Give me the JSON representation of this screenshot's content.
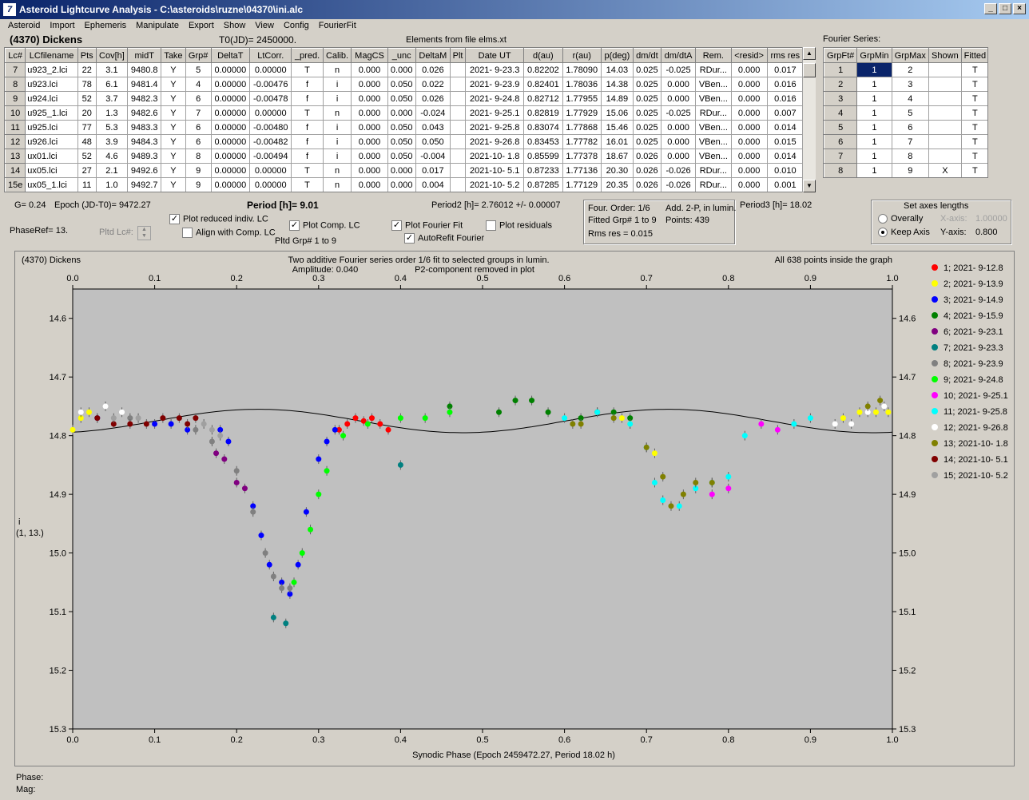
{
  "window": {
    "title": "Asteroid Lightcurve Analysis - C:\\asteroids\\ruzne\\04370\\ini.alc",
    "min": "_",
    "max": "□",
    "close": "×"
  },
  "menu": [
    "Asteroid",
    "Import",
    "Ephemeris",
    "Manipulate",
    "Export",
    "Show",
    "View",
    "Config",
    "FourierFit"
  ],
  "header": {
    "object": "(4370) Dickens",
    "t0": "T0(JD)= 2450000.",
    "elements": "Elements from file elms.xt",
    "fourier_label": "Fourier Series:"
  },
  "lc_table": {
    "columns": [
      "Lc#",
      "LCfilename",
      "Pts",
      "Cov[h]",
      "midT",
      "Take",
      "Grp#",
      "DeltaT",
      "LtCorr.",
      "_pred.",
      "Calib.",
      "MagCS",
      "_unc",
      "DeltaM",
      "Plt",
      "Date UT",
      "d(au)",
      "r(au)",
      "p(deg)",
      "dm/dt",
      "dm/dtA",
      "Rem.",
      "<resid>",
      "rms res"
    ],
    "rows": [
      [
        "7",
        "u923_2.lci",
        "22",
        "3.1",
        "9480.8",
        "Y",
        "5",
        "0.00000",
        "0.00000",
        "T",
        "n",
        "0.000",
        "0.000",
        "0.026",
        "",
        "2021- 9-23.3",
        "0.82202",
        "1.78090",
        "14.03",
        "0.025",
        "-0.025",
        "RDur...",
        "0.000",
        "0.017"
      ],
      [
        "8",
        "u923.lci",
        "78",
        "6.1",
        "9481.4",
        "Y",
        "4",
        "0.00000",
        "-0.00476",
        "f",
        "i",
        "0.000",
        "0.050",
        "0.022",
        "",
        "2021- 9-23.9",
        "0.82401",
        "1.78036",
        "14.38",
        "0.025",
        "0.000",
        "VBen...",
        "0.000",
        "0.016"
      ],
      [
        "9",
        "u924.lci",
        "52",
        "3.7",
        "9482.3",
        "Y",
        "6",
        "0.00000",
        "-0.00478",
        "f",
        "i",
        "0.000",
        "0.050",
        "0.026",
        "",
        "2021- 9-24.8",
        "0.82712",
        "1.77955",
        "14.89",
        "0.025",
        "0.000",
        "VBen...",
        "0.000",
        "0.016"
      ],
      [
        "10",
        "u925_1.lci",
        "20",
        "1.3",
        "9482.6",
        "Y",
        "7",
        "0.00000",
        "0.00000",
        "T",
        "n",
        "0.000",
        "0.000",
        "-0.024",
        "",
        "2021- 9-25.1",
        "0.82819",
        "1.77929",
        "15.06",
        "0.025",
        "-0.025",
        "RDur...",
        "0.000",
        "0.007"
      ],
      [
        "11",
        "u925.lci",
        "77",
        "5.3",
        "9483.3",
        "Y",
        "6",
        "0.00000",
        "-0.00480",
        "f",
        "i",
        "0.000",
        "0.050",
        "0.043",
        "",
        "2021- 9-25.8",
        "0.83074",
        "1.77868",
        "15.46",
        "0.025",
        "0.000",
        "VBen...",
        "0.000",
        "0.014"
      ],
      [
        "12",
        "u926.lci",
        "48",
        "3.9",
        "9484.3",
        "Y",
        "6",
        "0.00000",
        "-0.00482",
        "f",
        "i",
        "0.000",
        "0.050",
        "0.050",
        "",
        "2021- 9-26.8",
        "0.83453",
        "1.77782",
        "16.01",
        "0.025",
        "0.000",
        "VBen...",
        "0.000",
        "0.015"
      ],
      [
        "13",
        "ux01.lci",
        "52",
        "4.6",
        "9489.3",
        "Y",
        "8",
        "0.00000",
        "-0.00494",
        "f",
        "i",
        "0.000",
        "0.050",
        "-0.004",
        "",
        "2021-10- 1.8",
        "0.85599",
        "1.77378",
        "18.67",
        "0.026",
        "0.000",
        "VBen...",
        "0.000",
        "0.014"
      ],
      [
        "14",
        "ux05.lci",
        "27",
        "2.1",
        "9492.6",
        "Y",
        "9",
        "0.00000",
        "0.00000",
        "T",
        "n",
        "0.000",
        "0.000",
        "0.017",
        "",
        "2021-10- 5.1",
        "0.87233",
        "1.77136",
        "20.30",
        "0.026",
        "-0.026",
        "RDur...",
        "0.000",
        "0.010"
      ],
      [
        "15e",
        "ux05_1.lci",
        "11",
        "1.0",
        "9492.7",
        "Y",
        "9",
        "0.00000",
        "0.00000",
        "T",
        "n",
        "0.000",
        "0.000",
        "0.004",
        "",
        "2021-10- 5.2",
        "0.87285",
        "1.77129",
        "20.35",
        "0.026",
        "-0.026",
        "RDur...",
        "0.000",
        "0.001"
      ]
    ]
  },
  "fourier_table": {
    "columns": [
      "GrpFt#",
      "GrpMin",
      "GrpMax",
      "Shown",
      "Fitted"
    ],
    "rows": [
      [
        "1",
        "1",
        "2",
        "",
        "T"
      ],
      [
        "2",
        "1",
        "3",
        "",
        "T"
      ],
      [
        "3",
        "1",
        "4",
        "",
        "T"
      ],
      [
        "4",
        "1",
        "5",
        "",
        "T"
      ],
      [
        "5",
        "1",
        "6",
        "",
        "T"
      ],
      [
        "6",
        "1",
        "7",
        "",
        "T"
      ],
      [
        "7",
        "1",
        "8",
        "",
        "T"
      ],
      [
        "8",
        "1",
        "9",
        "X",
        "T"
      ]
    ]
  },
  "controls": {
    "g": "G= 0.24",
    "epoch": "Epoch (JD-T0)= 9472.27",
    "period": "Period [h]= 9.01",
    "period2": "Period2 [h]= 2.76012 +/- 0.00007",
    "period3": "Period3 [h]= 18.02",
    "phaseref": "PhaseRef= 13.",
    "pltd_lc": "Pltd Lc#:",
    "plot_reduced": "Plot reduced indiv. LC",
    "align_comp": "Align with Comp. LC",
    "plot_comp": "Plot Comp. LC",
    "pltd_grp": "Pltd Grp#  1   to   9",
    "plot_fourier": "Plot Fourier Fit",
    "autorefit": "AutoRefit Fourier",
    "plot_resid": "Plot residuals",
    "four_order": "Four. Order:  1/6",
    "add2p": "Add. 2-P, in lumin.",
    "fitted_grp": "Fitted Grp# 1 to 9",
    "points": "Points: 439",
    "rms_res": "Rms res      = 0.015",
    "axes_title": "Set axes lengths",
    "overally": "Overally",
    "keep_axis": "Keep Axis",
    "xaxis_label": "X-axis:",
    "xaxis_value": "1.00000",
    "yaxis_label": "Y-axis:",
    "yaxis_value": "0.800"
  },
  "plot": {
    "name": "(4370) Dickens",
    "subtitle1": "Two additive Fourier series order 1/6 fit to selected groups in lumin.",
    "subtitle2": "Amplitude: 0.040",
    "subtitle3": "P2-component removed in plot",
    "inside": "All 638 points inside the graph",
    "ylabel1": "i",
    "ylabel2": "(1, 13.)",
    "xlabel": "Synodic Phase (Epoch 2459472.27, Period 18.02 h)"
  },
  "status": {
    "phase": "Phase:",
    "mag": "Mag:"
  },
  "chart_data": {
    "type": "scatter",
    "xlim": [
      0.0,
      1.0
    ],
    "ylim": [
      15.3,
      14.55
    ],
    "x_ticks": [
      "0.0",
      "0.1",
      "0.2",
      "0.3",
      "0.4",
      "0.5",
      "0.6",
      "0.7",
      "0.8",
      "0.9",
      "1.0"
    ],
    "y_ticks": [
      "14.6",
      "14.7",
      "14.8",
      "14.9",
      "15.0",
      "15.1",
      "15.2",
      "15.3"
    ],
    "grid": false,
    "legend_position": "right",
    "series": [
      {
        "name": "1; 2021- 9-12.8",
        "color": "#ff0000",
        "points": [
          [
            0.325,
            14.79
          ],
          [
            0.335,
            14.78
          ],
          [
            0.345,
            14.77
          ],
          [
            0.355,
            14.775
          ],
          [
            0.365,
            14.77
          ],
          [
            0.375,
            14.78
          ],
          [
            0.385,
            14.79
          ]
        ]
      },
      {
        "name": "2; 2021- 9-13.9",
        "color": "#ffff00",
        "points": [
          [
            0.0,
            14.79
          ],
          [
            0.01,
            14.77
          ],
          [
            0.02,
            14.76
          ],
          [
            0.94,
            14.77
          ],
          [
            0.96,
            14.76
          ],
          [
            0.98,
            14.76
          ],
          [
            0.995,
            14.76
          ],
          [
            0.67,
            14.77
          ],
          [
            0.68,
            14.78
          ],
          [
            0.71,
            14.83
          ]
        ]
      },
      {
        "name": "3; 2021- 9-14.9",
        "color": "#0000ff",
        "points": [
          [
            0.03,
            14.77
          ],
          [
            0.1,
            14.78
          ],
          [
            0.12,
            14.78
          ],
          [
            0.14,
            14.79
          ],
          [
            0.18,
            14.79
          ],
          [
            0.19,
            14.81
          ],
          [
            0.22,
            14.92
          ],
          [
            0.23,
            14.97
          ],
          [
            0.24,
            15.02
          ],
          [
            0.255,
            15.05
          ],
          [
            0.265,
            15.07
          ],
          [
            0.275,
            15.02
          ],
          [
            0.285,
            14.93
          ],
          [
            0.3,
            14.84
          ],
          [
            0.31,
            14.81
          ],
          [
            0.32,
            14.79
          ]
        ]
      },
      {
        "name": "4; 2021- 9-15.9",
        "color": "#008000",
        "points": [
          [
            0.46,
            14.75
          ],
          [
            0.52,
            14.76
          ],
          [
            0.54,
            14.74
          ],
          [
            0.56,
            14.74
          ],
          [
            0.58,
            14.76
          ],
          [
            0.62,
            14.77
          ],
          [
            0.64,
            14.76
          ],
          [
            0.66,
            14.76
          ],
          [
            0.68,
            14.77
          ]
        ]
      },
      {
        "name": "6; 2021- 9-23.1",
        "color": "#800080",
        "points": [
          [
            0.175,
            14.83
          ],
          [
            0.185,
            14.84
          ],
          [
            0.2,
            14.88
          ],
          [
            0.21,
            14.89
          ]
        ]
      },
      {
        "name": "7; 2021- 9-23.3",
        "color": "#008080",
        "points": [
          [
            0.245,
            15.11
          ],
          [
            0.26,
            15.12
          ],
          [
            0.4,
            14.85
          ]
        ]
      },
      {
        "name": "8; 2021- 9-23.9",
        "color": "#808080",
        "points": [
          [
            0.07,
            14.77
          ],
          [
            0.15,
            14.79
          ],
          [
            0.17,
            14.81
          ],
          [
            0.2,
            14.86
          ],
          [
            0.22,
            14.93
          ],
          [
            0.235,
            15.0
          ],
          [
            0.245,
            15.04
          ],
          [
            0.255,
            15.06
          ],
          [
            0.265,
            15.06
          ]
        ]
      },
      {
        "name": "9; 2021- 9-24.8",
        "color": "#00ff00",
        "points": [
          [
            0.27,
            15.05
          ],
          [
            0.28,
            15.0
          ],
          [
            0.29,
            14.96
          ],
          [
            0.3,
            14.9
          ],
          [
            0.31,
            14.86
          ],
          [
            0.33,
            14.8
          ],
          [
            0.36,
            14.78
          ],
          [
            0.4,
            14.77
          ],
          [
            0.43,
            14.77
          ],
          [
            0.46,
            14.76
          ]
        ]
      },
      {
        "name": "10; 2021- 9-25.1",
        "color": "#ff00ff",
        "points": [
          [
            0.78,
            14.9
          ],
          [
            0.8,
            14.89
          ],
          [
            0.84,
            14.78
          ],
          [
            0.86,
            14.79
          ]
        ]
      },
      {
        "name": "11; 2021- 9-25.8",
        "color": "#00ffff",
        "points": [
          [
            0.6,
            14.77
          ],
          [
            0.64,
            14.76
          ],
          [
            0.68,
            14.78
          ],
          [
            0.7,
            14.82
          ],
          [
            0.71,
            14.88
          ],
          [
            0.72,
            14.91
          ],
          [
            0.74,
            14.92
          ],
          [
            0.76,
            14.89
          ],
          [
            0.78,
            14.88
          ],
          [
            0.8,
            14.87
          ],
          [
            0.82,
            14.8
          ],
          [
            0.88,
            14.78
          ],
          [
            0.9,
            14.77
          ]
        ]
      },
      {
        "name": "12; 2021- 9-26.8",
        "color": "#ffffff",
        "points": [
          [
            0.01,
            14.76
          ],
          [
            0.04,
            14.75
          ],
          [
            0.06,
            14.76
          ],
          [
            0.93,
            14.78
          ],
          [
            0.95,
            14.78
          ],
          [
            0.97,
            14.76
          ],
          [
            0.99,
            14.75
          ]
        ]
      },
      {
        "name": "13; 2021-10- 1.8",
        "color": "#808000",
        "points": [
          [
            0.61,
            14.78
          ],
          [
            0.62,
            14.78
          ],
          [
            0.66,
            14.77
          ],
          [
            0.7,
            14.82
          ],
          [
            0.72,
            14.87
          ],
          [
            0.73,
            14.92
          ],
          [
            0.745,
            14.9
          ],
          [
            0.76,
            14.88
          ],
          [
            0.78,
            14.88
          ],
          [
            0.97,
            14.75
          ],
          [
            0.985,
            14.74
          ]
        ]
      },
      {
        "name": "14; 2021-10- 5.1",
        "color": "#800000",
        "points": [
          [
            0.03,
            14.77
          ],
          [
            0.05,
            14.78
          ],
          [
            0.07,
            14.78
          ],
          [
            0.09,
            14.78
          ],
          [
            0.11,
            14.77
          ],
          [
            0.13,
            14.77
          ],
          [
            0.14,
            14.78
          ],
          [
            0.15,
            14.77
          ]
        ]
      },
      {
        "name": "15; 2021-10- 5.2",
        "color": "#a0a0a0",
        "points": [
          [
            0.16,
            14.78
          ],
          [
            0.17,
            14.79
          ],
          [
            0.18,
            14.8
          ],
          [
            0.05,
            14.77
          ],
          [
            0.08,
            14.77
          ]
        ]
      }
    ],
    "fit_curve_color": "#000000"
  }
}
